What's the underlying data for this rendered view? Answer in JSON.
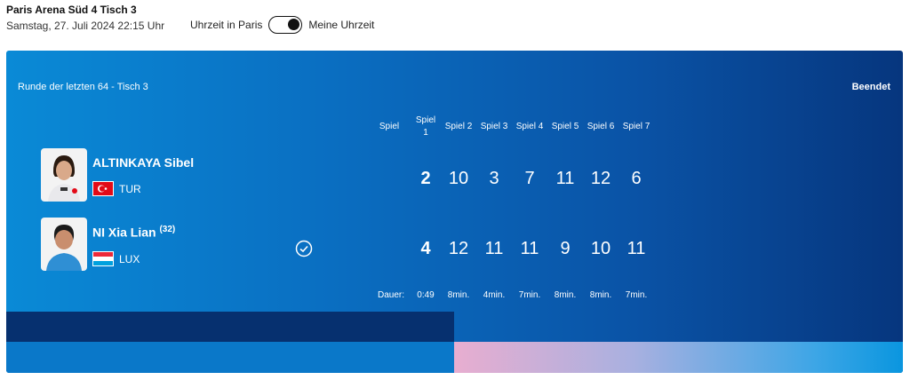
{
  "header": {
    "venue": "Paris Arena Süd 4 Tisch 3",
    "datetime": "Samstag, 27. Juli 2024 22:15 Uhr",
    "tz_left": "Uhrzeit in Paris",
    "tz_right": "Meine Uhrzeit"
  },
  "match": {
    "round": "Runde der letzten 64 - Tisch 3",
    "status": "Beendet",
    "game_label": "Spiel",
    "columns": [
      "Spiel\n1",
      "Spiel 2",
      "Spiel 3",
      "Spiel 4",
      "Spiel 5",
      "Spiel 6",
      "Spiel 7"
    ],
    "duration_label": "Dauer:",
    "total_duration": "0:49",
    "durations": [
      "8min.",
      "4min.",
      "7min.",
      "8min.",
      "8min.",
      "7min."
    ]
  },
  "players": [
    {
      "name": "ALTINKAYA Sibel",
      "seed": "",
      "country": "TUR",
      "games": "2",
      "scores": [
        "10",
        "3",
        "7",
        "11",
        "12",
        "6"
      ],
      "winner": false
    },
    {
      "name": "NI Xia Lian",
      "seed": "(32)",
      "country": "LUX",
      "games": "4",
      "scores": [
        "12",
        "11",
        "11",
        "9",
        "10",
        "11"
      ],
      "winner": true
    }
  ],
  "colors": {
    "card_dark": "#06367e",
    "card_light": "#0a8ad6",
    "flag_tur": "#e30a17",
    "flag_lux_top": "#ed2939",
    "flag_lux_bottom": "#00a1de"
  }
}
